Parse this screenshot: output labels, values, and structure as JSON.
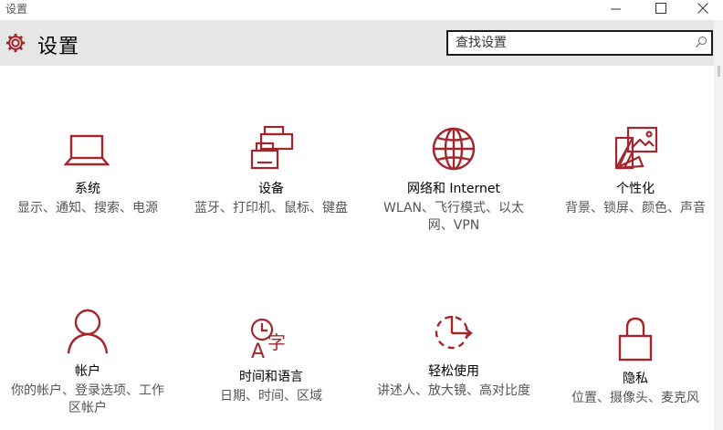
{
  "window": {
    "title": "设置",
    "minimize_icon": "minimize-icon",
    "maximize_icon": "maximize-icon",
    "close_icon": "close-icon"
  },
  "header": {
    "title": "设置",
    "icon": "gear-icon",
    "accent_color": "#a4262c",
    "search_placeholder": "查找设置",
    "search_value": "",
    "search_icon": "search-icon"
  },
  "tiles": [
    {
      "name": "系统",
      "desc": "显示、通知、搜索、电源",
      "icon": "laptop-icon"
    },
    {
      "name": "设备",
      "desc": "蓝牙、打印机、鼠标、键盘",
      "icon": "devices-icon"
    },
    {
      "name": "网络和 Internet",
      "desc": "WLAN、飞行模式、以太网、VPN",
      "icon": "globe-icon"
    },
    {
      "name": "个性化",
      "desc": "背景、锁屏、颜色、声音",
      "icon": "personalization-icon"
    },
    {
      "name": "帐户",
      "desc": "你的帐户、登录选项、工作区帐户",
      "icon": "person-icon"
    },
    {
      "name": "时间和语言",
      "desc": "日期、时间、区域",
      "icon": "time-language-icon"
    },
    {
      "name": "轻松使用",
      "desc": "讲述人、放大镜、高对比度",
      "icon": "ease-of-access-icon"
    },
    {
      "name": "隐私",
      "desc": "位置、摄像头、麦克风",
      "icon": "lock-icon"
    }
  ]
}
